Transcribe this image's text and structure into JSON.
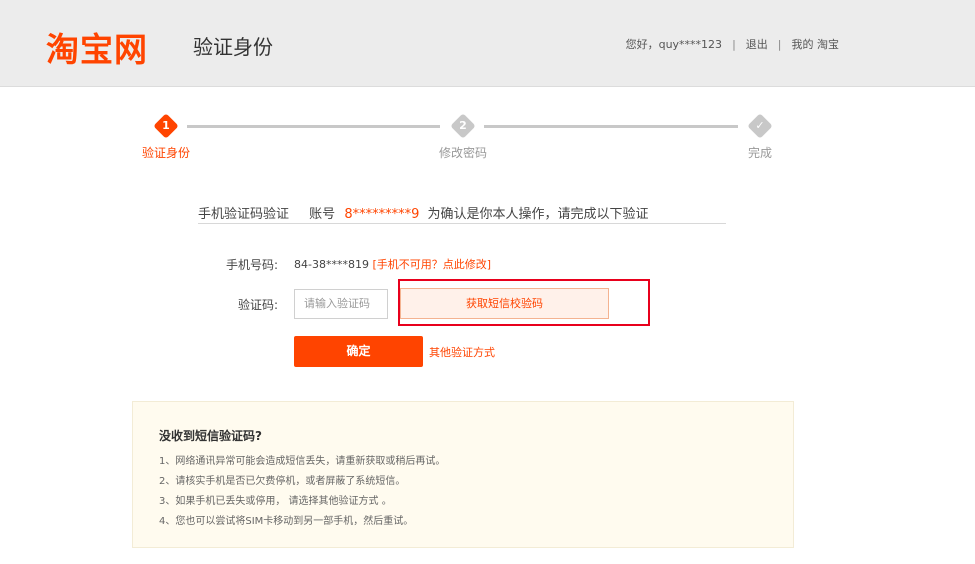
{
  "header": {
    "logo_text": "淘宝网",
    "title": "验证身份",
    "greeting": "您好，quy****123",
    "logout_label": "退出",
    "my_taobao_label": "我的 淘宝",
    "separator": "|"
  },
  "steps": [
    {
      "number": "1",
      "label": "验证身份",
      "state": "active"
    },
    {
      "number": "2",
      "label": "修改密码",
      "state": "pending"
    },
    {
      "number": "✓",
      "label": "完成",
      "state": "pending"
    }
  ],
  "verify": {
    "method_label": "手机验证码验证",
    "account_prefix": "账号",
    "account_value": "8*********9",
    "account_suffix": "为确认是你本人操作，请完成以下验证"
  },
  "form": {
    "phone_label": "手机号码:",
    "phone_value": "84-38****819",
    "phone_unavailable_link": "[手机不可用？点此修改]",
    "code_label": "验证码:",
    "code_placeholder": "请输入验证码",
    "sms_button_label": "获取短信校验码",
    "confirm_label": "确定",
    "other_method_link": "其他验证方式"
  },
  "tips": {
    "title": "没收到短信验证码?",
    "items": [
      "1、网络通讯异常可能会造成短信丢失，请重新获取或稍后再试。",
      "2、请核实手机是否已欠费停机，或者屏蔽了系统短信。",
      "3、如果手机已丢失或停用， 请选择其他验证方式 。",
      "4、您也可以尝试将SIM卡移动到另一部手机，然后重试。"
    ]
  },
  "colors": {
    "brand": "#ff4400",
    "step_inactive": "#c8c8c8",
    "highlight_box": "#e8001c"
  }
}
